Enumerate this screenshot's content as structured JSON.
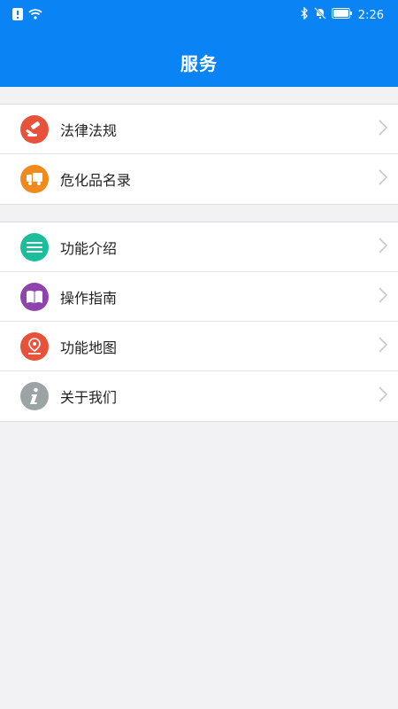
{
  "status_bar": {
    "time": "2:26"
  },
  "header": {
    "title": "服务"
  },
  "groups": [
    {
      "items": [
        {
          "label": "法律法规",
          "icon": "gavel-icon",
          "color": "#e8523a"
        },
        {
          "label": "危化品名录",
          "icon": "truck-icon",
          "color": "#f08a1d"
        }
      ]
    },
    {
      "items": [
        {
          "label": "功能介绍",
          "icon": "list-icon",
          "color": "#1bbd9a"
        },
        {
          "label": "操作指南",
          "icon": "book-icon",
          "color": "#8e44ad"
        },
        {
          "label": "功能地图",
          "icon": "location-pin-icon",
          "color": "#e8523a"
        },
        {
          "label": "关于我们",
          "icon": "info-icon",
          "color": "#9ba3a4"
        }
      ]
    }
  ]
}
